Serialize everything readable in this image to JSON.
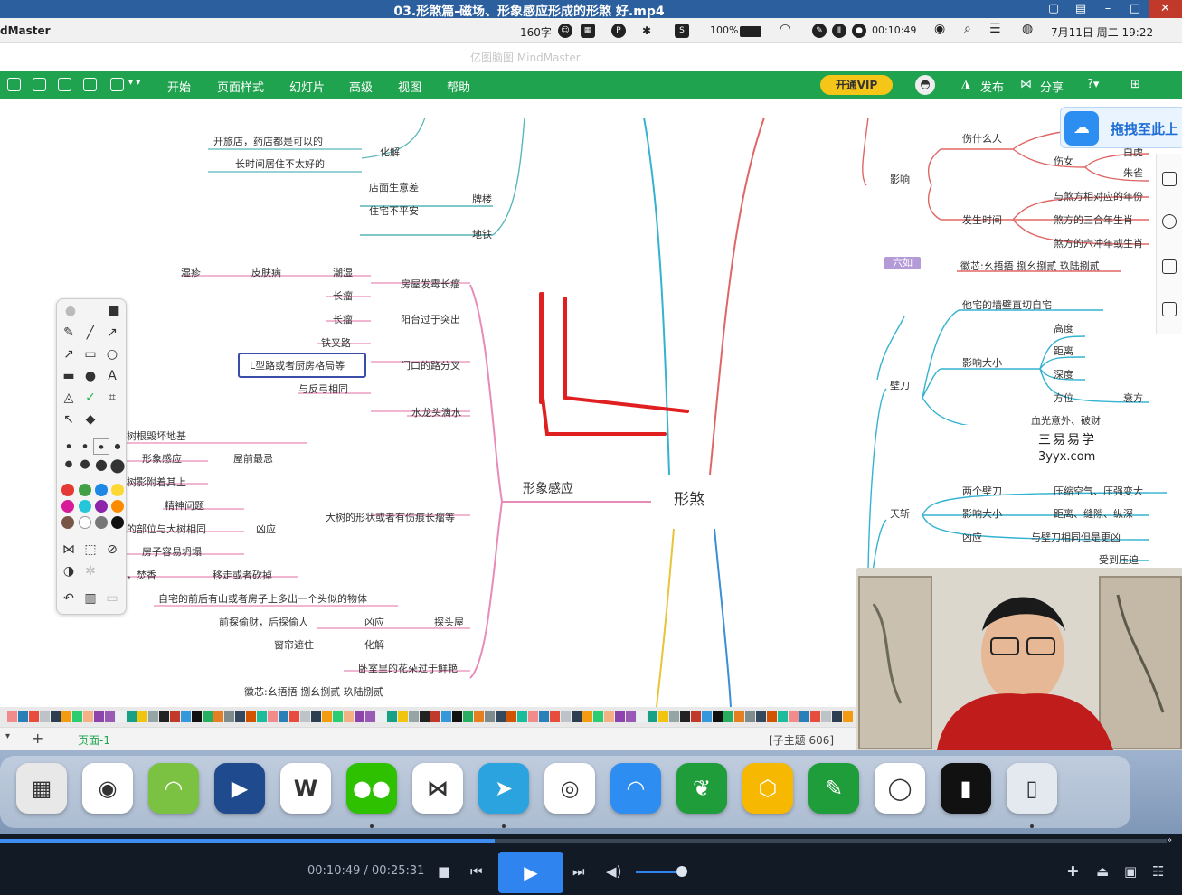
{
  "window": {
    "title": "03.形煞篇-磁场、形象感应形成的形煞 好.mp4"
  },
  "menubar": {
    "app_name": "dMaster",
    "word_count": "160字",
    "battery": "100%",
    "timer": "00:10:49",
    "datetime": "7月11日 周二 19:22"
  },
  "app": {
    "title": "亿图脑图 MindMaster"
  },
  "ribbon": {
    "menus": [
      "开始",
      "页面样式",
      "幻灯片",
      "高级",
      "视图",
      "帮助"
    ],
    "vip_label": "开通VIP",
    "publish_label": "发布",
    "share_label": "分享"
  },
  "baidu_popup": {
    "label": "拖拽至此上"
  },
  "mindmap": {
    "center": "形煞",
    "branch_main": "形象感应",
    "nodes_left": [
      "开旅店，药店都是可以的",
      "化解",
      "长时间居住不太好的",
      "店面生意差",
      "牌楼",
      "住宅不平安",
      "地铁",
      "湿疹",
      "皮肤病",
      "潮湿",
      "房屋发霉长瘤",
      "长瘤",
      "长瘤",
      "阳台过于突出",
      "铁叉路",
      "L型路或者厨房格局等",
      "门口的路分叉",
      "与反弓相同",
      "水龙头滴水",
      "树根毁坏地基",
      "形象感应",
      "屋前最忌",
      "树影附着其上",
      "精神问题",
      "大树的形状或者有伤痕长瘤等",
      "的部位与大树相同",
      "凶应",
      "房子容易坍塌",
      "，焚香",
      "移走或者砍掉",
      "自宅的前后有山或者房子上多出一个头似的物体",
      "前探偷财，后探偷人",
      "凶应",
      "探头屋",
      "窗帘遮住",
      "化解",
      "卧室里的花朵过于鲜艳",
      "徽芯:幺捂捂 捌幺捌贰 玖陆捌贰"
    ],
    "nodes_right": [
      "伤什么人",
      "白虎",
      "伤女",
      "朱雀",
      "影响",
      "与煞方相对应的年份",
      "发生时间",
      "煞方的三合年生肖",
      "煞方的六冲年或生肖",
      "六如",
      "徽芯:幺捂捂 捌幺捌贰 玖陆捌贰",
      "他宅的墙壁直切自宅",
      "高度",
      "影响大小",
      "距离",
      "深度",
      "壁刀",
      "方位",
      "衰方",
      "血光意外、破财",
      "两个壁刀",
      "压缩空气、压强变大",
      "天斩",
      "影响大小",
      "距离、缝隙、纵深",
      "凶应",
      "与壁刀相同但是更凶",
      "受到压迫"
    ]
  },
  "watermark": {
    "line1": "三易易学",
    "line2": "3yyx.com"
  },
  "pagebar": {
    "add": "+",
    "page_tab": "页面-1",
    "topic_count": "[子主题 606]"
  },
  "dock": {
    "apps": [
      {
        "name": "launchpad",
        "color": "#e8e8e8",
        "glyph": "▦"
      },
      {
        "name": "chrome",
        "color": "#ffffff",
        "glyph": "◉"
      },
      {
        "name": "android-studio",
        "color": "#7cc242",
        "glyph": "◠"
      },
      {
        "name": "infuse",
        "color": "#1f4b8e",
        "glyph": "▶"
      },
      {
        "name": "wps-office",
        "color": "#ffffff",
        "glyph": "W"
      },
      {
        "name": "wechat",
        "color": "#2dc100",
        "glyph": "●●"
      },
      {
        "name": "mindnode",
        "color": "#ffffff",
        "glyph": "⋈"
      },
      {
        "name": "telegram",
        "color": "#2aa3df",
        "glyph": "➤"
      },
      {
        "name": "aperture",
        "color": "#ffffff",
        "glyph": "◎"
      },
      {
        "name": "cat-app",
        "color": "#2e8df0",
        "glyph": "◠"
      },
      {
        "name": "evernote",
        "color": "#1f9d3a",
        "glyph": "❦"
      },
      {
        "name": "amorphous-app",
        "color": "#f6b800",
        "glyph": "⬡"
      },
      {
        "name": "paintbrush",
        "color": "#1f9d3a",
        "glyph": "✎"
      },
      {
        "name": "webcam-app",
        "color": "#ffffff",
        "glyph": "◯"
      },
      {
        "name": "rec-app",
        "color": "#111111",
        "glyph": "▮"
      },
      {
        "name": "trash",
        "color": "#e4e9ef",
        "glyph": "▯"
      }
    ]
  },
  "player": {
    "time": "00:10:49 / 00:25:31",
    "progress_fraction": 0.424,
    "volume_fraction": 0.85
  },
  "colors": {
    "ribbon": "#1fa34f",
    "titlebar": "#2c5f9e",
    "player": "#121a26",
    "accent": "#2f84ef"
  }
}
